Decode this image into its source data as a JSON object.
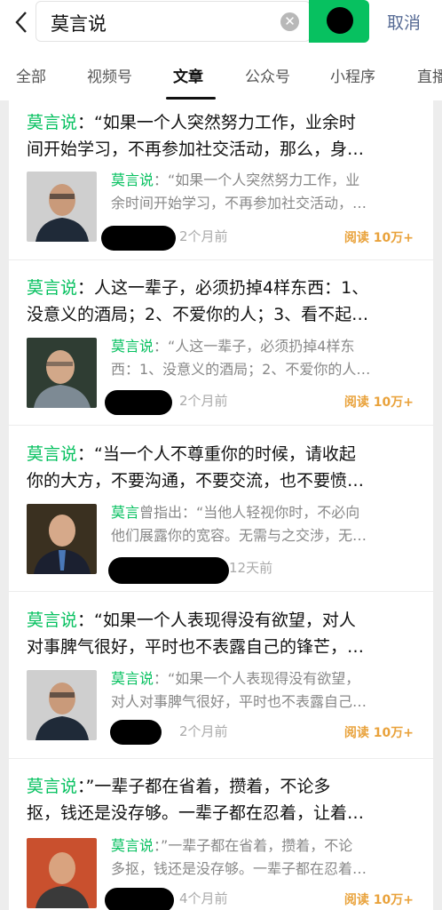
{
  "header": {
    "query": "莫言说",
    "cancel_label": "取消"
  },
  "tabs": [
    "全部",
    "视频号",
    "文章",
    "公众号",
    "小程序",
    "直播"
  ],
  "active_tab": "文章",
  "colors": {
    "accent": "#07c160",
    "link": "#576b95",
    "read": "#e9a23b"
  },
  "results": [
    {
      "title_hl": "莫言说",
      "title_line1": "：“如果一个人突然努力工作，业余时",
      "title_line2": "间开始学习，不再参加社交活动，那么，身…",
      "snippet_hl": "莫言说",
      "snippet_line1": "：“如果一个人突然努力工作，业",
      "snippet_line2": "余时间开始学习，不再参加社交活动，…",
      "time": "2个月前",
      "reads": "阅读 10万+",
      "thumb_icon": "portrait-photo"
    },
    {
      "title_hl": "莫言说",
      "title_line1": "：人这一辈子，必须扔掉4样东西：1、",
      "title_line2": "没意义的酒局；2、不爱你的人；3、看不起…",
      "snippet_hl": "莫言说",
      "snippet_line1": "：“人这一辈子，必须扔掉4样东",
      "snippet_line2": "西：1、没意义的酒局；2、不爱你的人…",
      "time": "2个月前",
      "reads": "阅读 10万+",
      "thumb_icon": "portrait-photo"
    },
    {
      "title_hl": "莫言说",
      "title_line1": "：“当一个人不尊重你的时候，请收起",
      "title_line2": "你的大方，不要沟通，不要交流，也不要愤…",
      "snippet_hl": "莫言",
      "snippet_line1": "曾指出：“当他人轻视你时，不必向",
      "snippet_line2": "他们展露你的宽容。无需与之交涉，无…",
      "time": "12天前",
      "reads": "",
      "thumb_icon": "portrait-photo"
    },
    {
      "title_hl": "莫言说",
      "title_line1": "：“如果一个人表现得没有欲望，对人",
      "title_line2": "对事脾气很好，平时也不表露自己的锋芒，…",
      "snippet_hl": "莫言说",
      "snippet_line1": "：“如果一个人表现得没有欲望，",
      "snippet_line2": "对人对事脾气很好，平时也不表露自己…",
      "time": "2个月前",
      "reads": "阅读 10万+",
      "thumb_icon": "portrait-photo"
    },
    {
      "title_hl": "莫言说",
      "title_line1": "：”一辈子都在省着，攒着，不论多",
      "title_line2": "抠，钱还是没存够。一辈子都在忍着，让着…",
      "snippet_hl": "莫言说",
      "snippet_line1": "：”一辈子都在省着，攒着，不论",
      "snippet_line2": "多抠，钱还是没存够。一辈子都在忍着…",
      "time": "4个月前",
      "reads": "阅读 10万+",
      "thumb_icon": "portrait-photo"
    }
  ]
}
